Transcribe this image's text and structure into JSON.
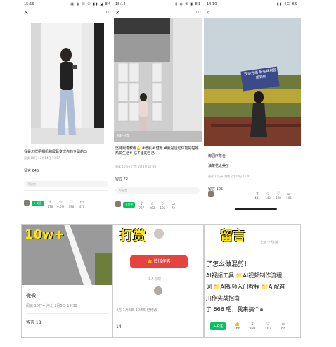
{
  "p1": {
    "status": {
      "time": "15:56",
      "icons": "▣ ◉ ✉ ✆  ▮▮ ◢ 84"
    },
    "nav": {
      "close": "×",
      "more": "···"
    },
    "title": "我是怎样把相机和屏幕变成你的专属的😊",
    "meta": "阅读 10万+  2月14日 13:57",
    "comment_label": "留言 645",
    "input_placeholder": "写留言",
    "actions": [
      {
        "icon": "⇪",
        "count": "176"
      },
      {
        "icon": "☆",
        "count": "9.6万"
      },
      {
        "icon": "♡",
        "count": "396"
      },
      {
        "icon": "▭",
        "count": "470"
      }
    ],
    "follow": "+关注"
  },
  "p2": {
    "status": {
      "time": "18:14",
      "icons": "▮ ◉ ✆ ▮ 81"
    },
    "nav": {
      "close": "×",
      "more": "···"
    },
    "title": "坚持跟着教练💪 #增肌# 健身 #我是运动体能的姑娘 热爱生活# 姑子里的自己",
    "meta": "阅读 10万+  广东 2月8日 17:33",
    "comment_label": "留言 72",
    "input_placeholder": "写留言",
    "actions": [
      {
        "icon": "⇪",
        "count": "757"
      },
      {
        "icon": "☆",
        "count": "283"
      },
      {
        "icon": "♡",
        "count": "105"
      },
      {
        "icon": "▭",
        "count": "72"
      }
    ],
    "follow": "+关注",
    "photo_label": "五彩·日常"
  },
  "p3": {
    "status": {
      "time": "14:10",
      "icons": "▮▮ 4G 69"
    },
    "nav": {
      "back": "‹"
    },
    "sign": "欢迎光临 新旺建材部 感谢你",
    "title": "御园序茶台",
    "subtitle": "油菜花太美了",
    "meta": "阅读 10万+  湖南 2月18日 15:41",
    "comment_label": "留言 105",
    "actions": [
      {
        "icon": "⇪",
        "count": "441"
      },
      {
        "icon": "☆",
        "count": "148"
      },
      {
        "icon": "♡",
        "count": "198"
      },
      {
        "icon": "▭",
        "count": "105"
      }
    ]
  },
  "p4": {
    "headline": "10w+",
    "title": "微微",
    "meta": "阅读 10万+  河北 2月5日 19:38",
    "comment_label": "留言 18"
  },
  "p5": {
    "headline": "打赏",
    "reward_button": "👍 怜惜作者",
    "reward_count": "3人喜欢",
    "meta": "4万  1月5日 10:55 已修改",
    "bottom_number": "14"
  },
  "p6": {
    "headline": "留言",
    "top_note": "上去 今天讨论",
    "lines": [
      "了怎么做混剪！",
      "AI视频工具 📁AI视频制作流程",
      "词 📁AI视频入门教程 📁AI配音",
      "川作实战指南",
      "了 666 吧，我来搞个ai"
    ],
    "follow": "+关注",
    "actions": [
      {
        "icon": "👍",
        "count": "166"
      },
      {
        "icon": "⇪",
        "count": "997"
      },
      {
        "icon": "♡",
        "count": "102"
      },
      {
        "icon": "▭",
        "count": "88"
      }
    ]
  }
}
